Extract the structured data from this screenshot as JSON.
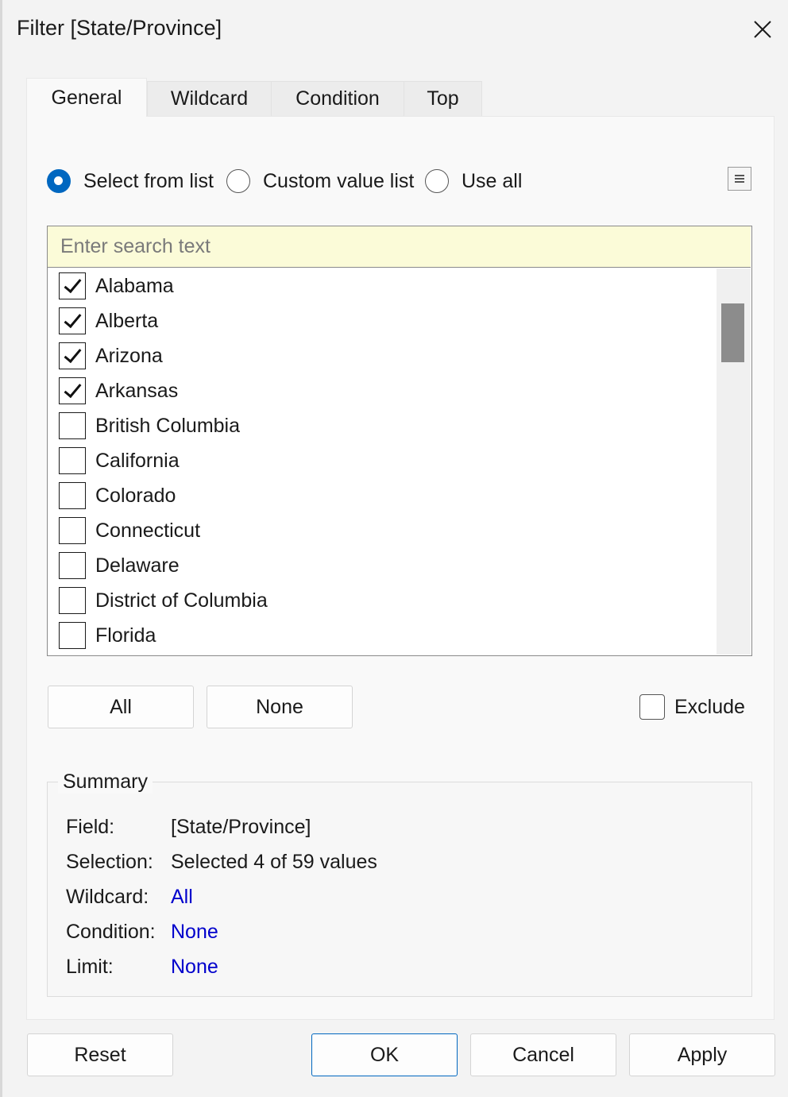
{
  "title": "Filter [State/Province]",
  "tabs": [
    {
      "label": "General"
    },
    {
      "label": "Wildcard"
    },
    {
      "label": "Condition"
    },
    {
      "label": "Top"
    }
  ],
  "mode": {
    "options": [
      {
        "label": "Select from list",
        "selected": true
      },
      {
        "label": "Custom value list",
        "selected": false
      },
      {
        "label": "Use all",
        "selected": false
      }
    ]
  },
  "search": {
    "placeholder": "Enter search text",
    "value": ""
  },
  "list": {
    "items": [
      {
        "label": "Alabama",
        "checked": true
      },
      {
        "label": "Alberta",
        "checked": true
      },
      {
        "label": "Arizona",
        "checked": true
      },
      {
        "label": "Arkansas",
        "checked": true
      },
      {
        "label": "British Columbia",
        "checked": false
      },
      {
        "label": "California",
        "checked": false
      },
      {
        "label": "Colorado",
        "checked": false
      },
      {
        "label": "Connecticut",
        "checked": false
      },
      {
        "label": "Delaware",
        "checked": false
      },
      {
        "label": "District of Columbia",
        "checked": false
      },
      {
        "label": "Florida",
        "checked": false
      }
    ]
  },
  "actions": {
    "all_label": "All",
    "none_label": "None",
    "exclude_label": "Exclude",
    "exclude_checked": false
  },
  "summary": {
    "legend": "Summary",
    "rows": [
      {
        "key": "Field:",
        "value": "[State/Province]",
        "link": false
      },
      {
        "key": "Selection:",
        "value": "Selected 4 of 59 values",
        "link": false
      },
      {
        "key": "Wildcard:",
        "value": "All",
        "link": true
      },
      {
        "key": "Condition:",
        "value": "None",
        "link": true
      },
      {
        "key": "Limit:",
        "value": "None",
        "link": true
      }
    ]
  },
  "footer": {
    "reset_label": "Reset",
    "ok_label": "OK",
    "cancel_label": "Cancel",
    "apply_label": "Apply"
  },
  "colors": {
    "accent": "#0067c0",
    "link": "#0000cc",
    "search_bg": "#fbfbd8"
  }
}
